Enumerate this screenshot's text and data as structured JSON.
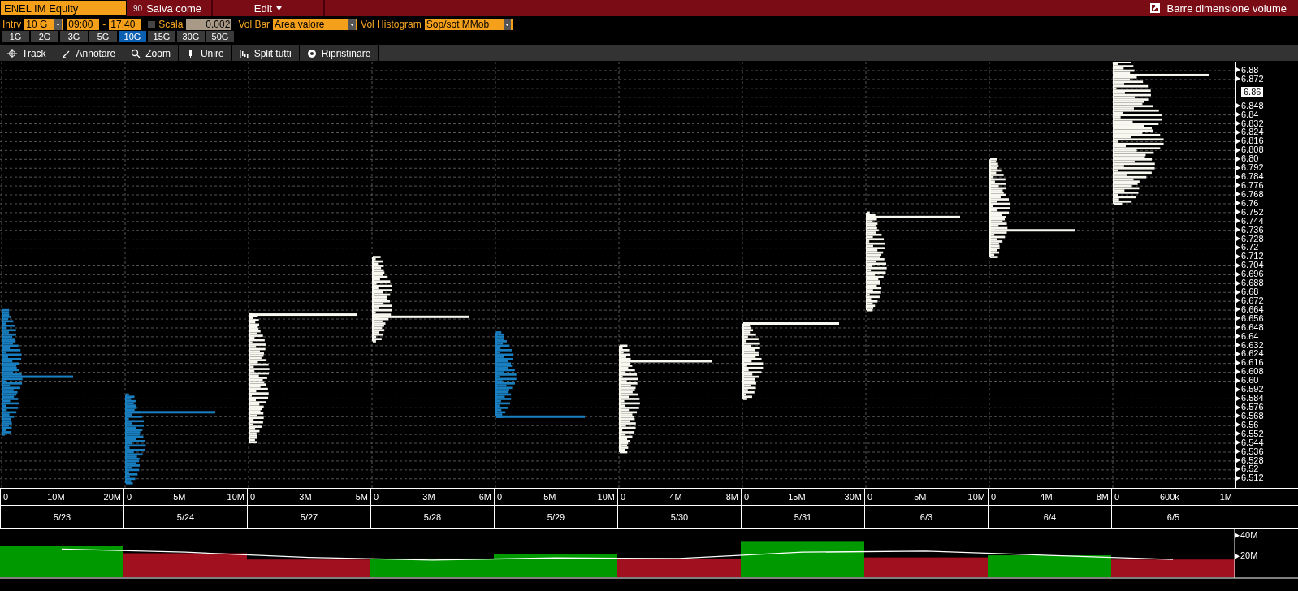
{
  "header": {
    "security": "ENEL IM Equity",
    "save_code": "90",
    "save_label": "Salva come",
    "edit_label": "Edit",
    "volume_size_label": "Barre dimensione volume"
  },
  "controls": {
    "interval_label": "Intrv",
    "interval": "10 G",
    "time_from": "09:00",
    "dash": "-",
    "time_to": "17:40",
    "scale_checked": false,
    "scale_label": "Scala",
    "scale_value": "0.002",
    "vol_bar_label": "Vol Bar",
    "vol_bar": "Area valore",
    "vol_hist_label": "Vol Histogram",
    "vol_hist": "Sop/sot MMob"
  },
  "periods": [
    {
      "label": "1G",
      "selected": false
    },
    {
      "label": "2G",
      "selected": false
    },
    {
      "label": "3G",
      "selected": false
    },
    {
      "label": "5G",
      "selected": false
    },
    {
      "label": "10G",
      "selected": true
    },
    {
      "label": "15G",
      "selected": false
    },
    {
      "label": "30G",
      "selected": false
    },
    {
      "label": "50G",
      "selected": false
    }
  ],
  "toolbar": [
    {
      "label": "Track",
      "kind": "crosshair"
    },
    {
      "label": "Annotare",
      "kind": "pencil"
    },
    {
      "label": "Zoom",
      "kind": "magnifier"
    },
    {
      "label": "Unire",
      "kind": "bar"
    },
    {
      "label": "Split tutti",
      "kind": "split"
    },
    {
      "label": "Ripristinare",
      "kind": "reset"
    }
  ],
  "price_axis": {
    "ticks": [
      "6.88",
      "6.872",
      "6.848",
      "6.84",
      "6.832",
      "6.824",
      "6.816",
      "6.808",
      "6.80",
      "6.792",
      "6.784",
      "6.776",
      "6.768",
      "6.76",
      "6.752",
      "6.744",
      "6.736",
      "6.728",
      "6.72",
      "6.712",
      "6.704",
      "6.696",
      "6.688",
      "6.68",
      "6.672",
      "6.664",
      "6.656",
      "6.648",
      "6.64",
      "6.632",
      "6.624",
      "6.616",
      "6.608",
      "6.60",
      "6.592",
      "6.584",
      "6.576",
      "6.568",
      "6.56",
      "6.552",
      "6.544",
      "6.536",
      "6.528",
      "6.52",
      "6.512"
    ],
    "last_price": "6.86"
  },
  "days": [
    {
      "date": "5/23",
      "volume_ticks": [
        "0",
        "10M",
        "20M"
      ]
    },
    {
      "date": "5/24",
      "volume_ticks": [
        "0",
        "5M",
        "10M"
      ]
    },
    {
      "date": "5/27",
      "volume_ticks": [
        "0",
        "3M",
        "5M"
      ]
    },
    {
      "date": "5/28",
      "volume_ticks": [
        "0",
        "3M",
        "6M"
      ]
    },
    {
      "date": "5/29",
      "volume_ticks": [
        "0",
        "5M",
        "10M"
      ]
    },
    {
      "date": "5/30",
      "volume_ticks": [
        "0",
        "4M",
        "8M"
      ]
    },
    {
      "date": "5/31",
      "volume_ticks": [
        "0",
        "15M",
        "30M"
      ]
    },
    {
      "date": "6/3",
      "volume_ticks": [
        "0",
        "5M",
        "10M"
      ]
    },
    {
      "date": "6/4",
      "volume_ticks": [
        "0",
        "4M",
        "8M"
      ]
    },
    {
      "date": "6/5",
      "volume_ticks": [
        "0",
        "600k",
        "1M"
      ]
    }
  ],
  "volume_chart": {
    "chart_data": {
      "type": "bar",
      "ylim": [
        0,
        46000000
      ],
      "yticks": [
        {
          "value": 20000000,
          "label": "20M"
        },
        {
          "value": 40000000,
          "label": "40M"
        }
      ],
      "series": [
        {
          "colors": [
            "#009a00",
            "#a0101e",
            "#a0101e",
            "#009a00",
            "#009a00",
            "#a0101e",
            "#009a00",
            "#a0101e",
            "#009a00",
            "#a0101e"
          ],
          "values": [
            30000000,
            23000000,
            17000000,
            18000000,
            22000000,
            18000000,
            34000000,
            19000000,
            21000000,
            17000000
          ]
        },
        {
          "type": "line",
          "color": "#ffffff",
          "values": [
            27000000,
            24000000,
            19000000,
            16500000,
            18500000,
            18000000,
            24000000,
            25000000,
            21000000,
            17000000
          ]
        }
      ]
    }
  }
}
